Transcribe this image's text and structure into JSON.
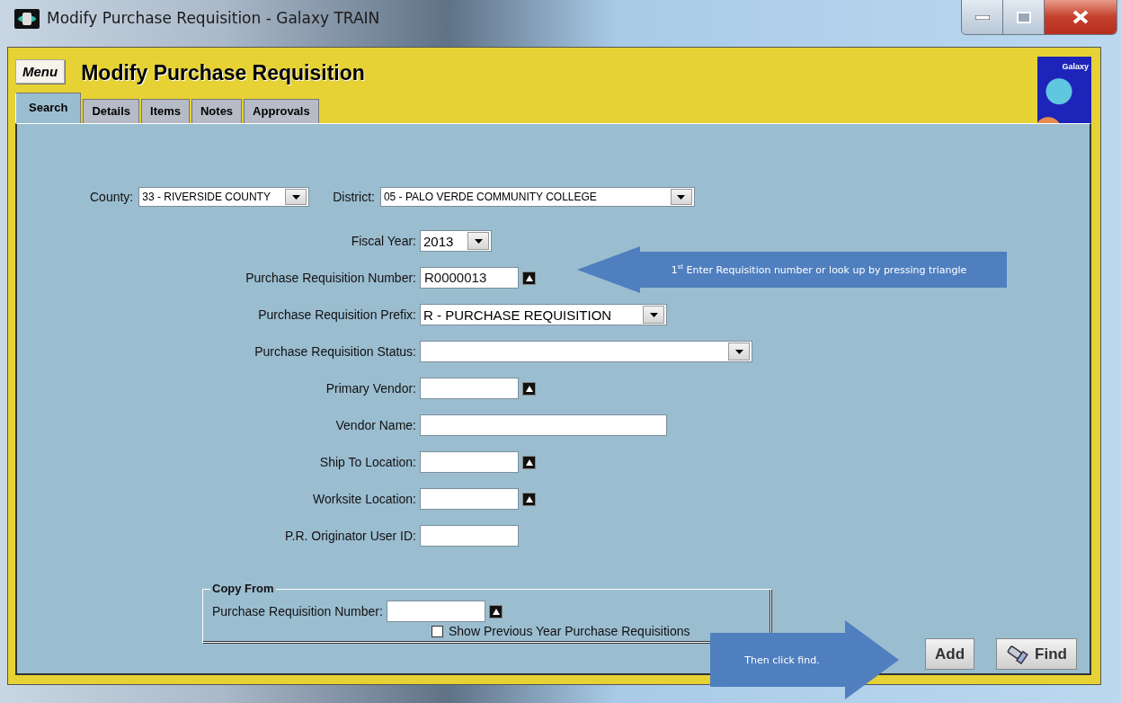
{
  "window": {
    "title": "Modify Purchase Requisition - Galaxy TRAIN"
  },
  "header": {
    "menu_button": "Menu",
    "title": "Modify Purchase Requisition",
    "logo_text": "Galaxy"
  },
  "tabs": [
    {
      "label": "Search",
      "selected": true
    },
    {
      "label": "Details",
      "selected": false
    },
    {
      "label": "Items",
      "selected": false
    },
    {
      "label": "Notes",
      "selected": false
    },
    {
      "label": "Approvals",
      "selected": false
    }
  ],
  "filters": [
    {
      "label": "County:",
      "value": "33 - RIVERSIDE COUNTY"
    },
    {
      "label": "District:",
      "value": "05 - PALO VERDE COMMUNITY COLLEGE"
    }
  ],
  "fields": [
    {
      "kind": "dropdown",
      "label": "Fiscal Year:",
      "value": "2013"
    },
    {
      "kind": "lookup",
      "label": "Purchase Requisition Number:",
      "value": "R0000013"
    },
    {
      "kind": "dropdown",
      "label": "Purchase Requisition Prefix:",
      "value": "R - PURCHASE REQUISITION"
    },
    {
      "kind": "dropdown",
      "label": "Purchase Requisition Status:"
    },
    {
      "kind": "lookup",
      "label": "Primary Vendor:"
    },
    {
      "kind": "text",
      "label": "Vendor Name:"
    },
    {
      "kind": "lookup",
      "label": "Ship To Location:"
    },
    {
      "kind": "lookup",
      "label": "Worksite Location:"
    },
    {
      "kind": "text",
      "label": "P.R. Originator User ID:"
    }
  ],
  "copy_from": {
    "title": "Copy From",
    "field": {
      "kind": "lookup",
      "label": "Purchase Requisition Number:"
    },
    "checkbox": {
      "label": "Show Previous Year Purchase Requisitions",
      "checked": false
    }
  },
  "buttons": [
    {
      "kind": "add",
      "label": "Add"
    },
    {
      "kind": "find",
      "label": "Find"
    }
  ],
  "callouts": [
    {
      "kind": "left",
      "text": "1$^{st}$ Enter Requisition number or look up by pressing triangle"
    },
    {
      "kind": "right",
      "text": "Then click find."
    }
  ]
}
